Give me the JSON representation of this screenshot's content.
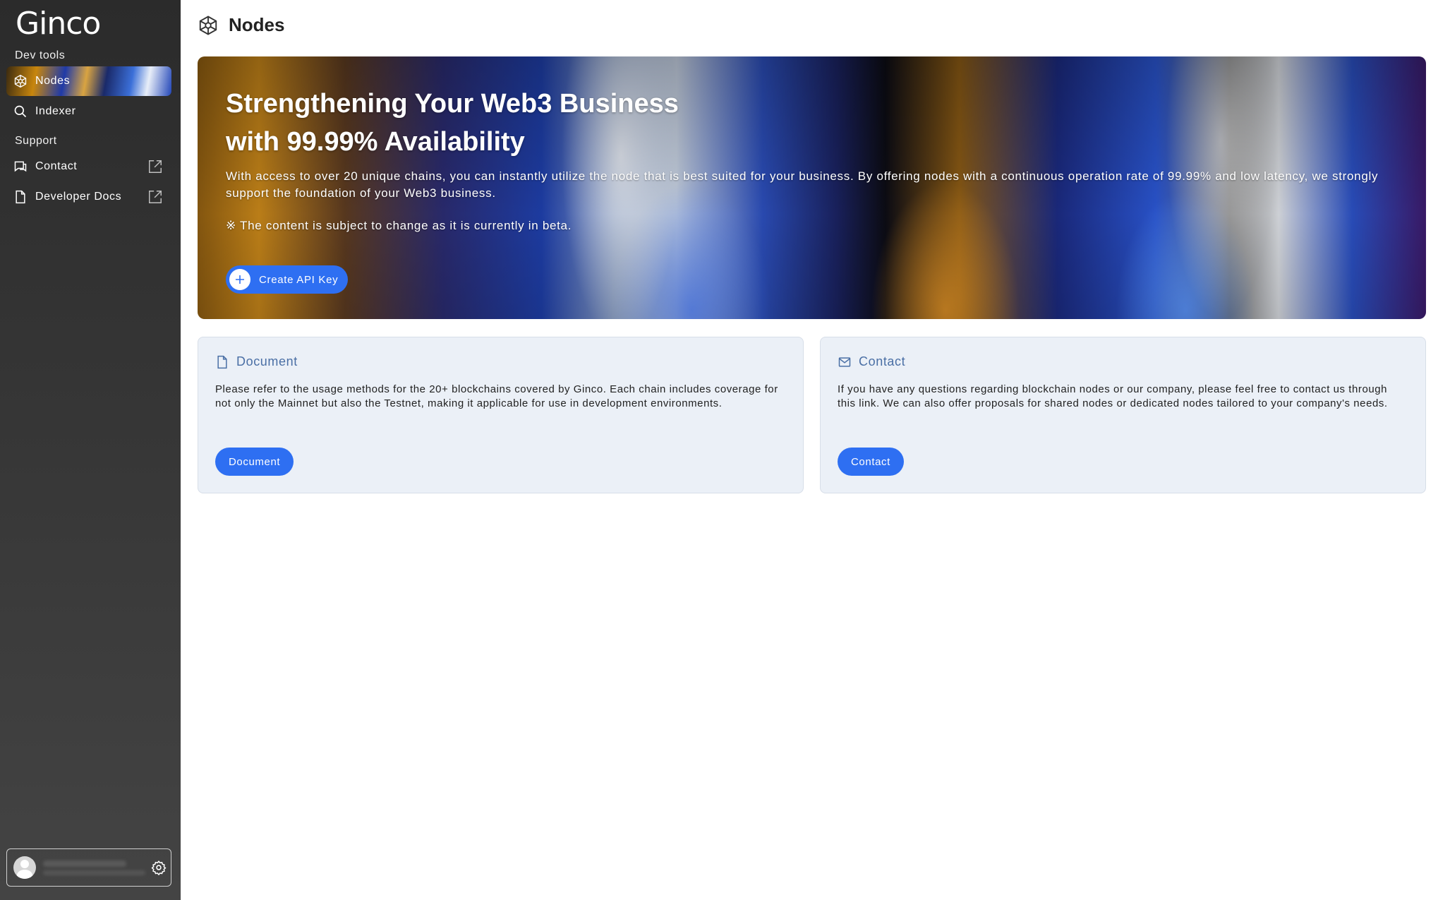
{
  "app": {
    "logo_text": "Ginco"
  },
  "sidebar": {
    "dev_tools_label": "Dev tools",
    "support_label": "Support",
    "items": [
      {
        "label": "Nodes",
        "icon": "nodes-icon",
        "active": true
      },
      {
        "label": "Indexer",
        "icon": "search-icon",
        "active": false
      },
      {
        "label": "Contact",
        "icon": "chat-icon",
        "external": true
      },
      {
        "label": "Developer Docs",
        "icon": "document-icon",
        "external": true
      }
    ],
    "user": {
      "name": "",
      "email": ""
    }
  },
  "header": {
    "title": "Nodes",
    "icon": "nodes-icon"
  },
  "hero": {
    "title_line1": "Strengthening Your Web3 Business",
    "title_line2": "with 99.99% Availability",
    "description": "With access to over 20 unique chains, you can instantly utilize the node that is best suited for your business. By offering nodes with a continuous operation rate of 99.99% and low latency, we strongly support the foundation of your Web3 business.",
    "note": "※ The content is subject to change as it is currently in beta.",
    "button_label": "Create API Key"
  },
  "cards": {
    "document": {
      "title": "Document",
      "body": "Please refer to the usage methods for the 20+ blockchains covered by Ginco. Each chain includes coverage for not only the Mainnet but also the Testnet, making it applicable for use in development environments.",
      "button_label": "Document"
    },
    "contact": {
      "title": "Contact",
      "body": "If you have any questions regarding blockchain nodes or our company, please feel free to contact us through this link. We can also offer proposals for shared nodes or dedicated nodes tailored to your company's needs.",
      "button_label": "Contact"
    }
  },
  "colors": {
    "accent": "#2e6ff2",
    "sidebar_bg": "#2b2b2b",
    "card_bg": "#ebf0f7",
    "card_title": "#4a6fa5"
  }
}
